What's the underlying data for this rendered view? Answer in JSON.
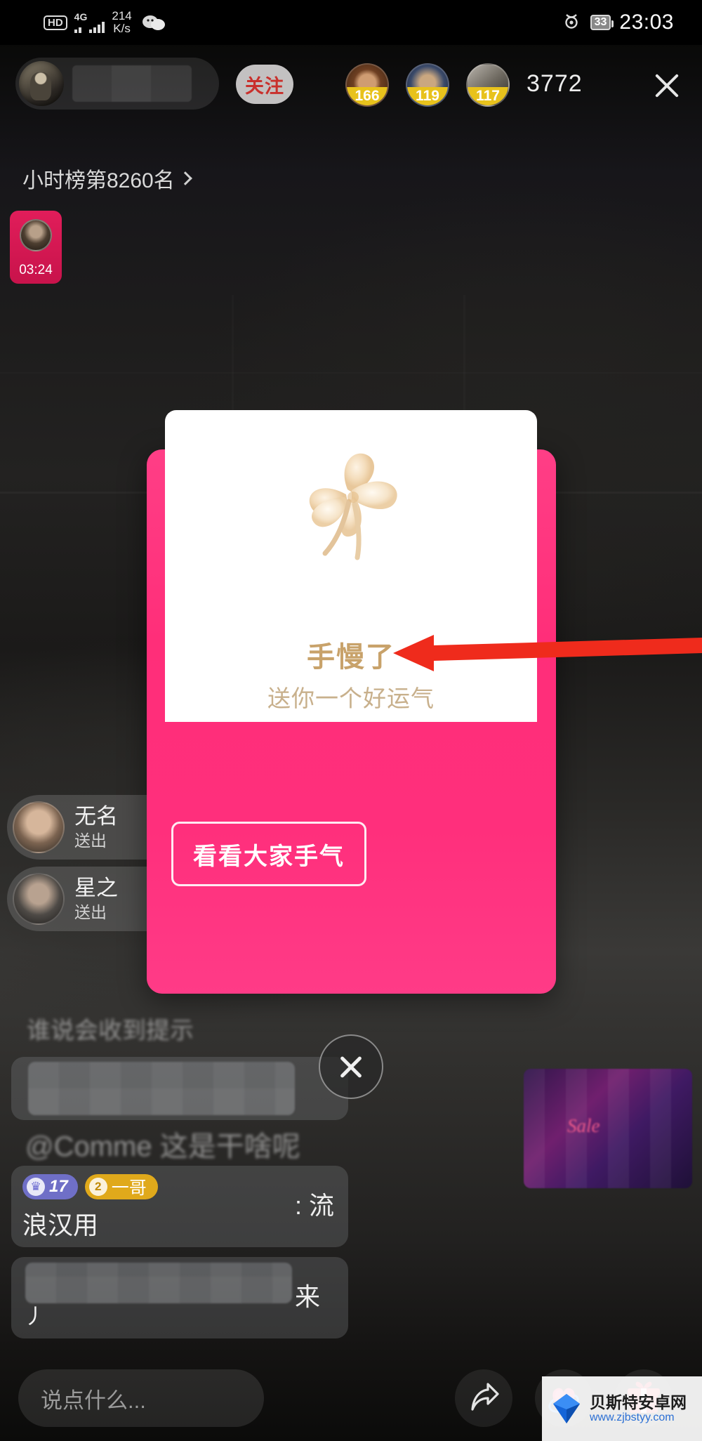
{
  "statusbar": {
    "hd_label": "HD",
    "network_type": "4G",
    "speed_value": "214",
    "speed_unit": "K/s",
    "wechat_icon": "wechat-icon",
    "eye_icon": "eye-care-icon",
    "battery_level": "33",
    "time": "23:03"
  },
  "header": {
    "host_avatar": "host-avatar",
    "host_name_masked": "",
    "follow_label": "关注",
    "viewers": [
      {
        "avatar": "viewer-avatar-1",
        "count": "166"
      },
      {
        "avatar": "viewer-avatar-2",
        "count": "119"
      },
      {
        "avatar": "viewer-avatar-3",
        "count": "117"
      }
    ],
    "viewer_total": "3772",
    "close_icon": "close-icon",
    "rank_label": "小时榜第8260名",
    "rank_chevron": "chevron-right-icon",
    "replay_time": "03:24"
  },
  "gift_toasts": [
    {
      "name": "无名",
      "action": "送出"
    },
    {
      "name": "星之",
      "action": "送出"
    }
  ],
  "chat": {
    "ghost_line_1": "谁说会收到提示",
    "mention_line": "@Comme 这是干啥呢",
    "badges": {
      "level_icon": "crown-icon",
      "level_value": "17",
      "fan_icon": "fan-club-icon",
      "fan_level": "2",
      "fan_name": "一哥"
    },
    "msg_tail_1": ": 流",
    "msg_body_1": "浪汉用",
    "msg_tail_2": "来",
    "msg_body_2": "丿"
  },
  "gift_banner": {
    "script_text": "Sale"
  },
  "packet": {
    "clover_icon": "four-leaf-clover-icon",
    "title": "手慢了",
    "subtitle": "送你一个好运气",
    "button_label": "看看大家手气",
    "close_icon": "close-icon",
    "accent_pink": "#ff2e79",
    "accent_gold": "#c8a26a"
  },
  "annotation": {
    "arrow_color": "#ef2b1c",
    "arrow_icon": "left-arrow-annotation"
  },
  "bottombar": {
    "input_placeholder": "说点什么...",
    "input_value": "",
    "share_icon": "share-icon",
    "heart_icon": "heart-icon",
    "gift_icon": "gift-icon"
  },
  "watermark": {
    "icon": "site-logo-icon",
    "site_name": "贝斯特安卓网",
    "site_url": "www.zjbstyy.com"
  }
}
